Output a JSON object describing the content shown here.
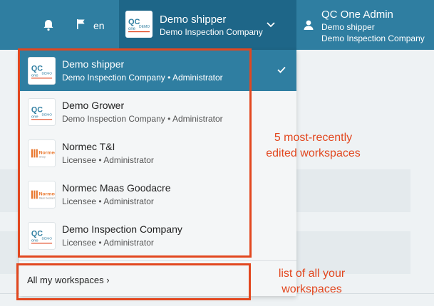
{
  "header": {
    "language": "en",
    "current_workspace": {
      "name": "Demo shipper",
      "org": "Demo Inspection Company"
    },
    "user": {
      "name": "QC One Admin",
      "workspace": "Demo shipper",
      "org": "Demo Inspection Company"
    }
  },
  "dropdown": {
    "items": [
      {
        "name": "Demo shipper",
        "sub": "Demo Inspection Company • Administrator",
        "logo": "qc-one",
        "selected": true
      },
      {
        "name": "Demo Grower",
        "sub": "Demo Inspection Company • Administrator",
        "logo": "qc-one",
        "selected": false
      },
      {
        "name": "Normec T&I",
        "sub": "Licensee • Administrator",
        "logo": "normec",
        "selected": false
      },
      {
        "name": "Normec Maas Goodacre",
        "sub": "Licensee • Administrator",
        "logo": "normec",
        "selected": false
      },
      {
        "name": "Demo Inspection Company",
        "sub": "Licensee • Administrator",
        "logo": "qc-one",
        "selected": false
      }
    ],
    "all_workspaces_label": "All my workspaces ›"
  },
  "annotations": {
    "recent": [
      "5 most-recently",
      "edited workspaces"
    ],
    "all": [
      "list of all your",
      "workspaces"
    ]
  },
  "colors": {
    "header": "#2f7ea1",
    "switcher": "#1e6688",
    "selected": "#2f7ea1",
    "annotation": "#e2471f"
  }
}
